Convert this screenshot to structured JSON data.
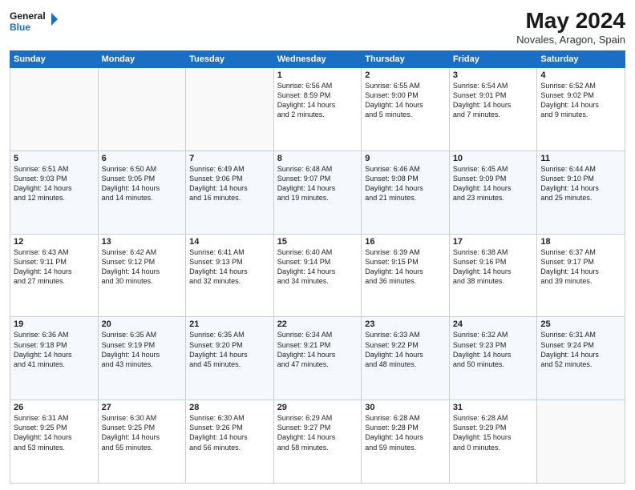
{
  "header": {
    "logo_line1": "General",
    "logo_line2": "Blue",
    "month": "May 2024",
    "location": "Novales, Aragon, Spain"
  },
  "weekdays": [
    "Sunday",
    "Monday",
    "Tuesday",
    "Wednesday",
    "Thursday",
    "Friday",
    "Saturday"
  ],
  "weeks": [
    [
      {
        "day": "",
        "text": ""
      },
      {
        "day": "",
        "text": ""
      },
      {
        "day": "",
        "text": ""
      },
      {
        "day": "1",
        "text": "Sunrise: 6:56 AM\nSunset: 8:59 PM\nDaylight: 14 hours\nand 2 minutes."
      },
      {
        "day": "2",
        "text": "Sunrise: 6:55 AM\nSunset: 9:00 PM\nDaylight: 14 hours\nand 5 minutes."
      },
      {
        "day": "3",
        "text": "Sunrise: 6:54 AM\nSunset: 9:01 PM\nDaylight: 14 hours\nand 7 minutes."
      },
      {
        "day": "4",
        "text": "Sunrise: 6:52 AM\nSunset: 9:02 PM\nDaylight: 14 hours\nand 9 minutes."
      }
    ],
    [
      {
        "day": "5",
        "text": "Sunrise: 6:51 AM\nSunset: 9:03 PM\nDaylight: 14 hours\nand 12 minutes."
      },
      {
        "day": "6",
        "text": "Sunrise: 6:50 AM\nSunset: 9:05 PM\nDaylight: 14 hours\nand 14 minutes."
      },
      {
        "day": "7",
        "text": "Sunrise: 6:49 AM\nSunset: 9:06 PM\nDaylight: 14 hours\nand 16 minutes."
      },
      {
        "day": "8",
        "text": "Sunrise: 6:48 AM\nSunset: 9:07 PM\nDaylight: 14 hours\nand 19 minutes."
      },
      {
        "day": "9",
        "text": "Sunrise: 6:46 AM\nSunset: 9:08 PM\nDaylight: 14 hours\nand 21 minutes."
      },
      {
        "day": "10",
        "text": "Sunrise: 6:45 AM\nSunset: 9:09 PM\nDaylight: 14 hours\nand 23 minutes."
      },
      {
        "day": "11",
        "text": "Sunrise: 6:44 AM\nSunset: 9:10 PM\nDaylight: 14 hours\nand 25 minutes."
      }
    ],
    [
      {
        "day": "12",
        "text": "Sunrise: 6:43 AM\nSunset: 9:11 PM\nDaylight: 14 hours\nand 27 minutes."
      },
      {
        "day": "13",
        "text": "Sunrise: 6:42 AM\nSunset: 9:12 PM\nDaylight: 14 hours\nand 30 minutes."
      },
      {
        "day": "14",
        "text": "Sunrise: 6:41 AM\nSunset: 9:13 PM\nDaylight: 14 hours\nand 32 minutes."
      },
      {
        "day": "15",
        "text": "Sunrise: 6:40 AM\nSunset: 9:14 PM\nDaylight: 14 hours\nand 34 minutes."
      },
      {
        "day": "16",
        "text": "Sunrise: 6:39 AM\nSunset: 9:15 PM\nDaylight: 14 hours\nand 36 minutes."
      },
      {
        "day": "17",
        "text": "Sunrise: 6:38 AM\nSunset: 9:16 PM\nDaylight: 14 hours\nand 38 minutes."
      },
      {
        "day": "18",
        "text": "Sunrise: 6:37 AM\nSunset: 9:17 PM\nDaylight: 14 hours\nand 39 minutes."
      }
    ],
    [
      {
        "day": "19",
        "text": "Sunrise: 6:36 AM\nSunset: 9:18 PM\nDaylight: 14 hours\nand 41 minutes."
      },
      {
        "day": "20",
        "text": "Sunrise: 6:35 AM\nSunset: 9:19 PM\nDaylight: 14 hours\nand 43 minutes."
      },
      {
        "day": "21",
        "text": "Sunrise: 6:35 AM\nSunset: 9:20 PM\nDaylight: 14 hours\nand 45 minutes."
      },
      {
        "day": "22",
        "text": "Sunrise: 6:34 AM\nSunset: 9:21 PM\nDaylight: 14 hours\nand 47 minutes."
      },
      {
        "day": "23",
        "text": "Sunrise: 6:33 AM\nSunset: 9:22 PM\nDaylight: 14 hours\nand 48 minutes."
      },
      {
        "day": "24",
        "text": "Sunrise: 6:32 AM\nSunset: 9:23 PM\nDaylight: 14 hours\nand 50 minutes."
      },
      {
        "day": "25",
        "text": "Sunrise: 6:31 AM\nSunset: 9:24 PM\nDaylight: 14 hours\nand 52 minutes."
      }
    ],
    [
      {
        "day": "26",
        "text": "Sunrise: 6:31 AM\nSunset: 9:25 PM\nDaylight: 14 hours\nand 53 minutes."
      },
      {
        "day": "27",
        "text": "Sunrise: 6:30 AM\nSunset: 9:25 PM\nDaylight: 14 hours\nand 55 minutes."
      },
      {
        "day": "28",
        "text": "Sunrise: 6:30 AM\nSunset: 9:26 PM\nDaylight: 14 hours\nand 56 minutes."
      },
      {
        "day": "29",
        "text": "Sunrise: 6:29 AM\nSunset: 9:27 PM\nDaylight: 14 hours\nand 58 minutes."
      },
      {
        "day": "30",
        "text": "Sunrise: 6:28 AM\nSunset: 9:28 PM\nDaylight: 14 hours\nand 59 minutes."
      },
      {
        "day": "31",
        "text": "Sunrise: 6:28 AM\nSunset: 9:29 PM\nDaylight: 15 hours\nand 0 minutes."
      },
      {
        "day": "",
        "text": ""
      }
    ]
  ]
}
